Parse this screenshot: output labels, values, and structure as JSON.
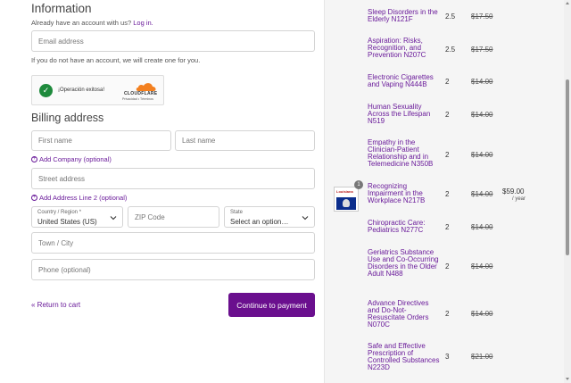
{
  "information": {
    "heading": "Information",
    "have_account_text": "Already have an account with us?",
    "login_link": "Log in.",
    "email_placeholder": "Email address",
    "no_account_note": "If you do not have an account, we will create one for you."
  },
  "captcha": {
    "status": "¡Operación exitosa!",
    "brand": "CLOUDFLARE",
    "privacy": "Privacidad",
    "sep": "•",
    "terms": "Términos"
  },
  "billing": {
    "heading": "Billing address",
    "first_name_placeholder": "First name",
    "last_name_placeholder": "Last name",
    "add_company": "Add Company (optional)",
    "street_placeholder": "Street address",
    "add_address2": "Add Address Line 2 (optional)",
    "country_label": "Country / Region *",
    "country_value": "United States (US)",
    "zip_placeholder": "ZIP Code",
    "state_label": "State",
    "state_value": "Select an option…",
    "city_placeholder": "Town / City",
    "phone_placeholder": "Phone (optional)"
  },
  "actions": {
    "return_to_cart": "« Return to cart",
    "continue": "Continue to payment"
  },
  "cart": {
    "items": [
      {
        "name": "Sleep Disorders in the Elderly N121F",
        "qty": "2.5",
        "price": "$17.50"
      },
      {
        "name": "Aspiration: Risks, Recognition, and Prevention N207C",
        "qty": "2.5",
        "price": "$17.50"
      },
      {
        "name": "Electronic Cigarettes and Vaping N444B",
        "qty": "2",
        "price": "$14.00"
      },
      {
        "name": "Human Sexuality Across the Lifespan N519",
        "qty": "2",
        "price": "$14.00"
      },
      {
        "name": "Empathy in the Clinician-Patient Relationship and in Telemedicine N350B",
        "qty": "2",
        "price": "$14.00"
      },
      {
        "name": "Recognizing Impairment in the Workplace N217B",
        "qty": "2",
        "price": "$14.00",
        "sale": "$59.00",
        "per": "/ year",
        "badge": "1",
        "thumb_text": "Louisiana"
      },
      {
        "name": "Chiropractic Care: Pediatrics N277C",
        "qty": "2",
        "price": "$14.00"
      },
      {
        "name": "Geriatrics Substance Use and Co-Occurring Disorders in the Older Adult N488",
        "qty": "2",
        "price": "$14.00"
      },
      {
        "name": "Advance Directives and Do-Not-Resuscitate Orders N070C",
        "qty": "2",
        "price": "$14.00"
      },
      {
        "name": "Safe and Effective Prescription of Controlled Substances N223D",
        "qty": "3",
        "price": "$21.00"
      }
    ]
  }
}
